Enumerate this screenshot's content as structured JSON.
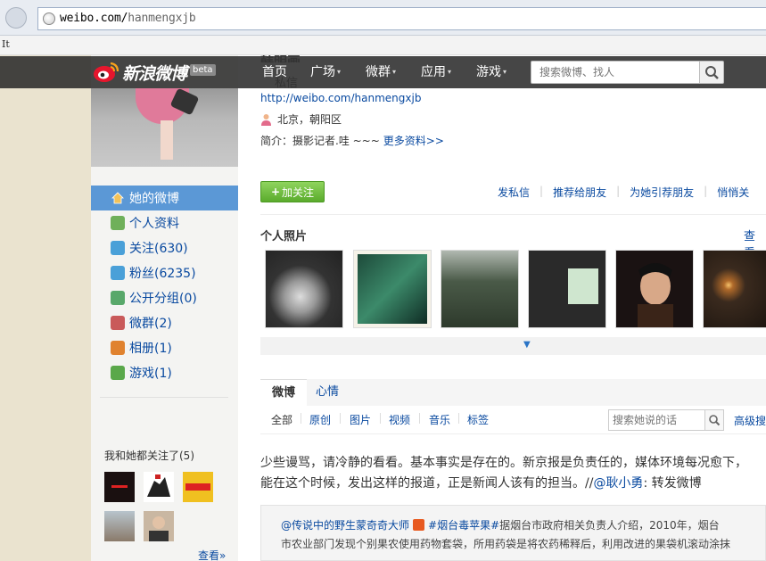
{
  "browser": {
    "url_host": "weibo.com/",
    "url_path": "hanmengxjb",
    "bookmark": "It"
  },
  "topnav": {
    "logo_text": "新浪微博",
    "beta": "beta",
    "items": [
      {
        "label": "首页",
        "dropdown": false
      },
      {
        "label": "广场",
        "dropdown": true
      },
      {
        "label": "微群",
        "dropdown": true
      },
      {
        "label": "应用",
        "dropdown": true
      },
      {
        "label": "游戏",
        "dropdown": true
      }
    ],
    "caret": "▾",
    "search_placeholder": "搜索微博、找人"
  },
  "profile": {
    "name_partial": "韩明画",
    "message_partial": "私信",
    "url": "http://weibo.com/hanmengxjb",
    "location": "北京，朝阳区",
    "bio": "简介：摄影记者.哇 ~~~",
    "more_info": "更多资料>>"
  },
  "sidebar": {
    "menu": [
      {
        "label": "她的微博",
        "icon": "home-icon",
        "color": "#e8a93a"
      },
      {
        "label": "个人资料",
        "icon": "profile-icon",
        "color": "#6fb05a"
      },
      {
        "label": "关注(630)",
        "icon": "follow-icon",
        "color": "#4aa0d8"
      },
      {
        "label": "粉丝(6235)",
        "icon": "fans-icon",
        "color": "#4aa0d8"
      },
      {
        "label": "公开分组(0)",
        "icon": "group-icon",
        "color": "#58a86a"
      },
      {
        "label": "微群(2)",
        "icon": "weiqun-icon",
        "color": "#c95a5a"
      },
      {
        "label": "相册(1)",
        "icon": "album-icon",
        "color": "#e0822e"
      },
      {
        "label": "游戏(1)",
        "icon": "game-icon",
        "color": "#5aa84a"
      }
    ],
    "common_follow_title": "我和她都关注了(5)",
    "more": "查看»"
  },
  "actions": {
    "follow_button": "加关注",
    "links": [
      "发私信",
      "推荐给朋友",
      "为她引荐朋友",
      "悄悄关"
    ]
  },
  "photos": {
    "title": "个人照片",
    "more": "查看",
    "expand_icon": "▼"
  },
  "feed": {
    "tabs": [
      "微博",
      "心情"
    ],
    "filters": [
      "全部",
      "原创",
      "图片",
      "视频",
      "音乐",
      "标签"
    ],
    "search_placeholder": "搜索她说的话",
    "advanced_search": "高级搜"
  },
  "post": {
    "text_line1": "少些谩骂，请冷静的看看。基本事实是存在的。新京报是负责任的，媒体环境每况愈下，",
    "text_line2_a": "能在这个时候，发出这样的报道，正是新闻人该有的担当。//",
    "mention": "@耿小勇",
    "text_line2_b": ": 转发微博",
    "repost_user": "@传说中的野生蒙奇奇大师",
    "repost_topic": "#烟台毒苹果#",
    "repost_line1": "据烟台市政府相关负责人介绍，2010年，烟台",
    "repost_line2": "市农业部门发现个别果农使用药物套袋，所用药袋是将农药稀释后，利用改进的果袋机滚动涂抹"
  }
}
